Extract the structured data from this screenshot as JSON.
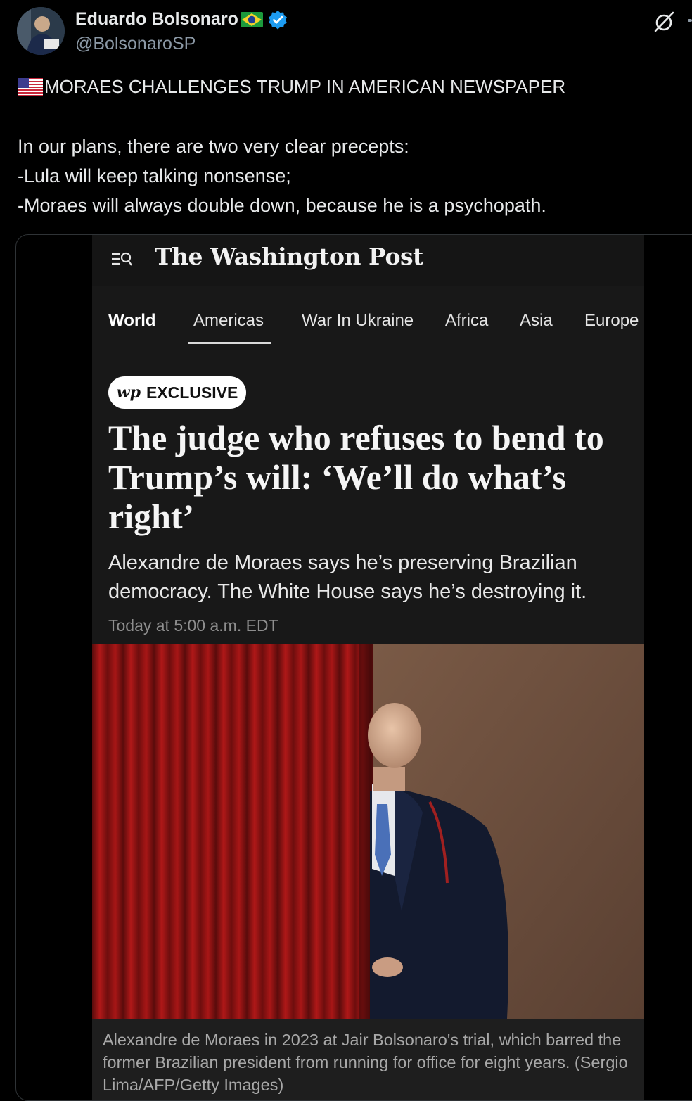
{
  "tweet": {
    "display_name": "Eduardo Bolsonaro",
    "handle": "@BolsonaroSP",
    "icons": [
      "avatar",
      "brazil-flag-icon",
      "verified-badge-icon",
      "grok-icon",
      "us-flag-icon"
    ],
    "headline": "MORAES CHALLENGES TRUMP IN AMERICAN NEWSPAPER",
    "lines": [
      "In our plans, there are two very clear precepts:",
      "-Lula will keep talking nonsense;",
      "-Moraes will always double down, because he is a psychopath."
    ],
    "accent_color": "#1d9bf0"
  },
  "article": {
    "masthead": "The Washington Post",
    "nav_tabs": [
      "World",
      "Americas",
      "War In Ukraine",
      "Africa",
      "Asia",
      "Europe"
    ],
    "active_tab": "World",
    "selected_tab": "Americas",
    "badge_logo": "wp",
    "badge_label": "EXCLUSIVE",
    "title": "The judge who refuses to bend to Trump’s will: ‘We’ll do what’s right’",
    "subtitle": "Alexandre de Moraes says he’s preserving Brazilian democracy. The White House says he’s destroying it.",
    "date": "Today at 5:00 a.m. EDT",
    "caption": "Alexandre de Moraes in 2023 at Jair Bolsonaro's trial, which barred the former Brazilian president from running for office for eight years. (Sergio Lima/AFP/Getty Images)"
  }
}
